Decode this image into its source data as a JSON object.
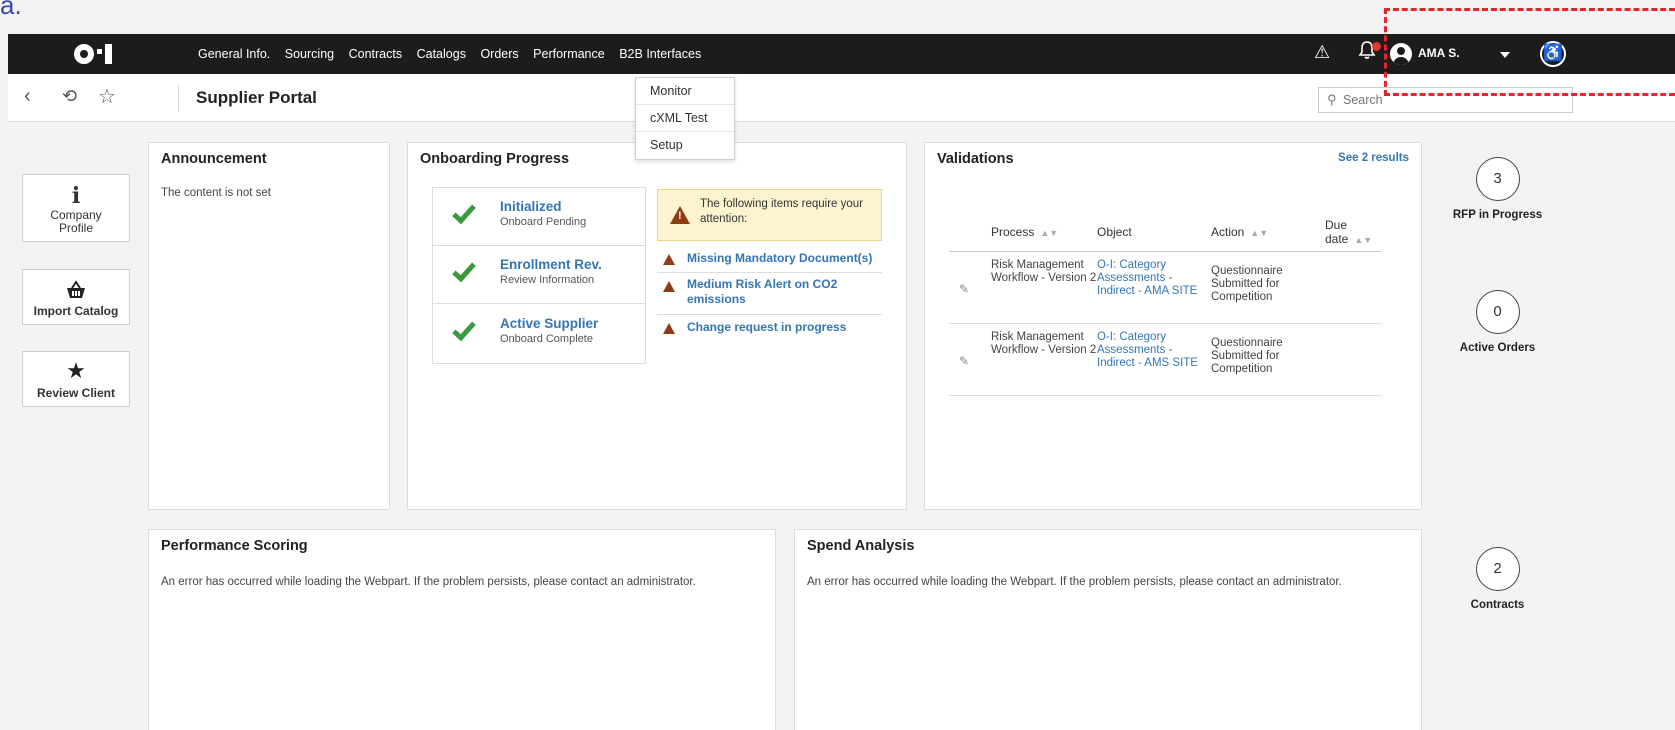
{
  "stray_char": "a.",
  "nav": {
    "logo_icon": "oi-logo",
    "menu": [
      "General Info.",
      "Sourcing",
      "Contracts",
      "Catalogs",
      "Orders",
      "Performance",
      "B2B Interfaces"
    ],
    "user_name": "AMA S.",
    "warning_icon": "⚠",
    "bell_icon": "🔔",
    "access_icon": "♿"
  },
  "subbar": {
    "back": "‹",
    "history": "⟲",
    "star": "☆",
    "title": "Supplier Portal",
    "search_placeholder": "Search"
  },
  "dropdown": [
    "Monitor",
    "cXML Test",
    "Setup"
  ],
  "quick_actions": [
    {
      "label": "Company Profile",
      "icon": "info-icon"
    },
    {
      "label": "Import Catalog",
      "icon": "basket-icon"
    },
    {
      "label": "Review Client",
      "icon": "star-icon"
    }
  ],
  "announcement": {
    "title": "Announcement",
    "body": "The content is not set"
  },
  "onboarding": {
    "title": "Onboarding Progress",
    "steps": [
      {
        "title": "Initialized",
        "subtitle": "Onboard Pending"
      },
      {
        "title": "Enrollment Rev.",
        "subtitle": "Review Information"
      },
      {
        "title": "Active Supplier",
        "subtitle": "Onboard Complete"
      }
    ],
    "attention": "The following items require your attention:",
    "alerts": [
      "Missing Mandatory Document(s)",
      "Medium Risk Alert on CO2 emissions",
      "Change request in progress"
    ]
  },
  "validations": {
    "title": "Validations",
    "see_results": "See 2 results",
    "columns": [
      "Process",
      "Object",
      "Action",
      "Due date"
    ],
    "rows": [
      {
        "process": "Risk Management Workflow - Version 2",
        "object": "O-I: Category Assessments - Indirect - AMA SITE",
        "action": "Questionnaire Submitted for Competition",
        "due": ""
      },
      {
        "process": "Risk Management Workflow - Version 2",
        "object": "O-I: Category Assessments - Indirect - AMS SITE",
        "action": "Questionnaire Submitted for Competition",
        "due": ""
      }
    ]
  },
  "performance": {
    "title": "Performance Scoring",
    "body": "An error has occurred while loading the Webpart. If the problem persists, please contact an administrator."
  },
  "spend": {
    "title": "Spend Analysis",
    "body": "An error has occurred while loading the Webpart. If the problem persists, please contact an administrator."
  },
  "stats": [
    {
      "value": "3",
      "label": "RFP in Progress"
    },
    {
      "value": "0",
      "label": "Active Orders"
    },
    {
      "value": "2",
      "label": "Contracts"
    }
  ]
}
